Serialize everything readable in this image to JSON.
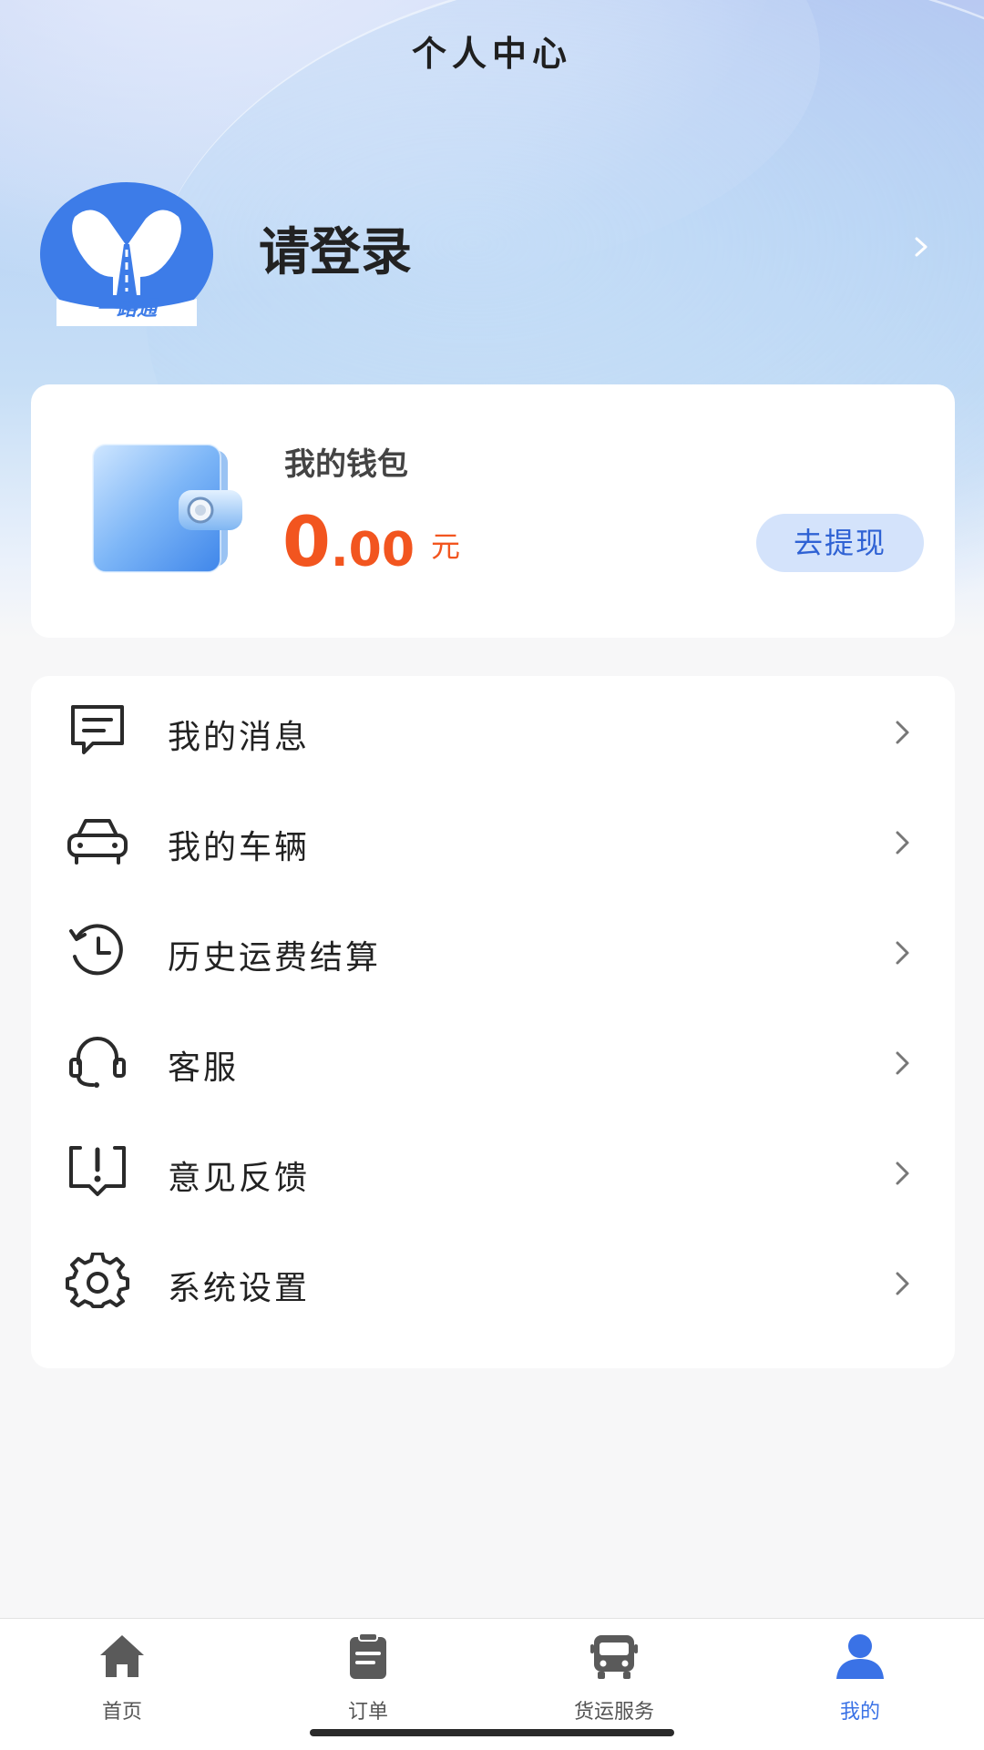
{
  "header": {
    "title": "个人中心"
  },
  "profile": {
    "avatar_brand_text": "一路通",
    "login_label": "请登录"
  },
  "wallet": {
    "label": "我的钱包",
    "amount_int": "0",
    "amount_dec": ".00",
    "unit": "元",
    "withdraw_label": "去提现"
  },
  "menu": {
    "items": [
      {
        "label": "我的消息",
        "icon": "message-icon"
      },
      {
        "label": "我的车辆",
        "icon": "car-icon"
      },
      {
        "label": "历史运费结算",
        "icon": "history-icon"
      },
      {
        "label": "客服",
        "icon": "headset-icon"
      },
      {
        "label": "意见反馈",
        "icon": "feedback-icon"
      },
      {
        "label": "系统设置",
        "icon": "gear-icon"
      }
    ]
  },
  "tabbar": {
    "tabs": [
      {
        "label": "首页",
        "icon": "home-icon",
        "active": false
      },
      {
        "label": "订单",
        "icon": "order-icon",
        "active": false
      },
      {
        "label": "货运服务",
        "icon": "bus-icon",
        "active": false
      },
      {
        "label": "我的",
        "icon": "user-icon",
        "active": true
      }
    ]
  },
  "colors": {
    "accent": "#3a72e6",
    "amount": "#f2551f",
    "withdraw_bg": "#d4e3fb",
    "inactive_icon": "#5a5a5a"
  }
}
